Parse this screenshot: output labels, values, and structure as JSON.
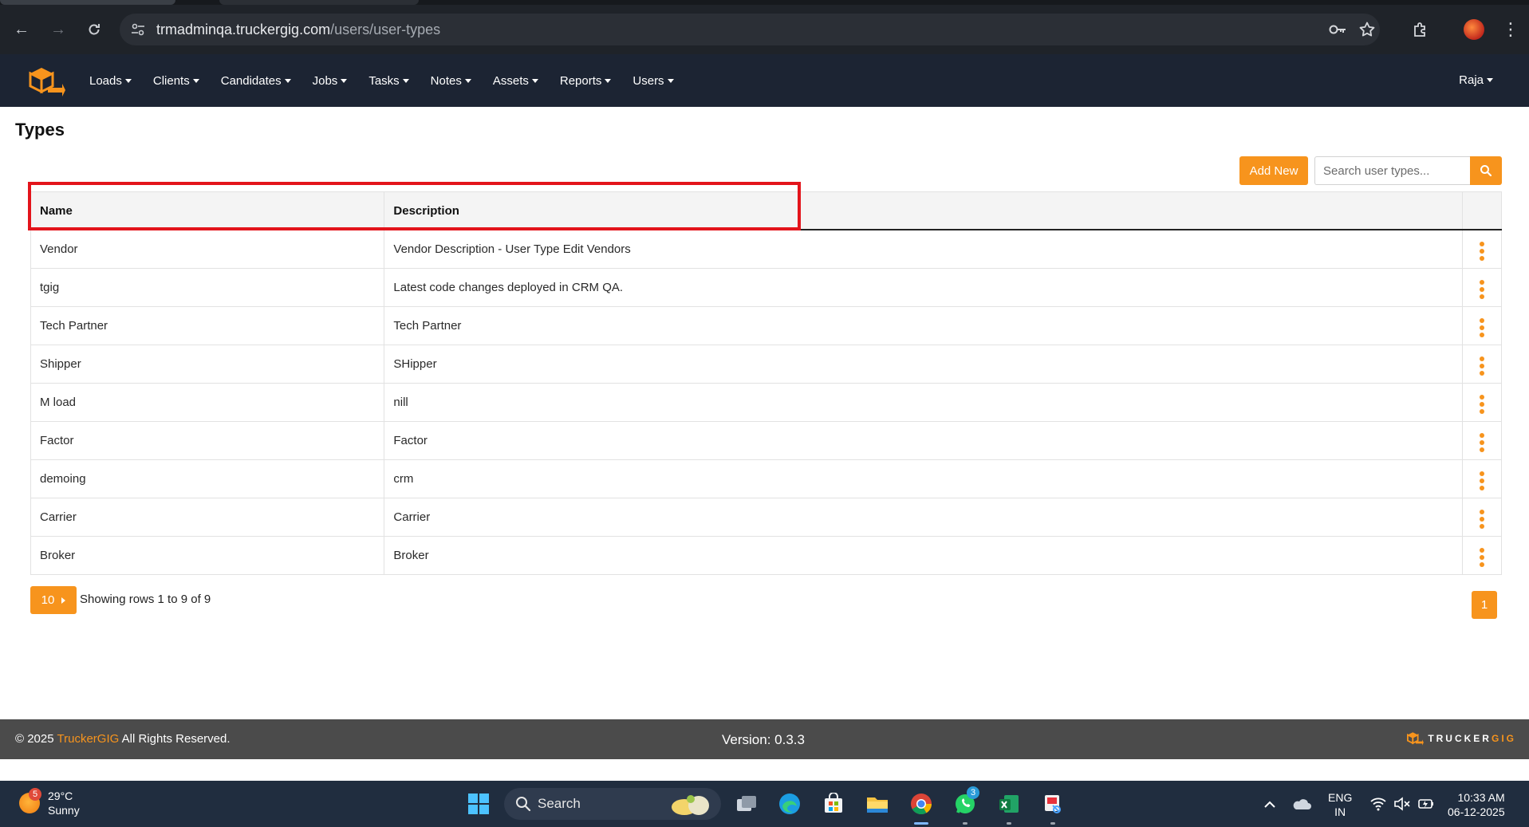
{
  "browser": {
    "url_host": "trmadminqa.truckergig.com",
    "url_path": "/users/user-types"
  },
  "navbar": {
    "menu": [
      {
        "label": "Loads"
      },
      {
        "label": "Clients"
      },
      {
        "label": "Candidates"
      },
      {
        "label": "Jobs"
      },
      {
        "label": "Tasks"
      },
      {
        "label": "Notes"
      },
      {
        "label": "Assets"
      },
      {
        "label": "Reports"
      },
      {
        "label": "Users"
      }
    ],
    "user": "Raja"
  },
  "page": {
    "title": "Types",
    "add_new_label": "Add New",
    "search_placeholder": "Search user types..."
  },
  "table": {
    "headers": {
      "name": "Name",
      "description": "Description"
    },
    "rows": [
      {
        "name": "Vendor",
        "description": "Vendor Description - User Type Edit Vendors"
      },
      {
        "name": "tgig",
        "description": "Latest code changes deployed in CRM QA."
      },
      {
        "name": "Tech Partner",
        "description": "Tech Partner"
      },
      {
        "name": "Shipper",
        "description": "SHipper"
      },
      {
        "name": "M load",
        "description": "nill"
      },
      {
        "name": "Factor",
        "description": "Factor"
      },
      {
        "name": "demoing",
        "description": "crm"
      },
      {
        "name": "Carrier",
        "description": "Carrier"
      },
      {
        "name": "Broker",
        "description": "Broker"
      }
    ]
  },
  "pagination": {
    "page_size": "10",
    "rows_info": "Showing rows 1 to 9 of 9",
    "current_page": "1"
  },
  "footer": {
    "copyright_prefix": "© 2025 ",
    "brand": "TruckerGIG",
    "copyright_suffix": " All Rights Reserved.",
    "version": "Version: 0.3.3",
    "logo_word_a": "TRUCKER",
    "logo_word_b": "GIG"
  },
  "taskbar": {
    "weather_badge": "5",
    "temperature": "29°C",
    "condition": "Sunny",
    "search_label": "Search",
    "whatsapp_badge": "3",
    "lang_line1": "ENG",
    "lang_line2": "IN",
    "time": "10:33 AM",
    "date": "06-12-2025"
  },
  "colors": {
    "accent": "#f7941d",
    "navbar_bg": "#1c2433",
    "highlight": "#e3141b",
    "footer_bg": "#4b4b4b"
  }
}
